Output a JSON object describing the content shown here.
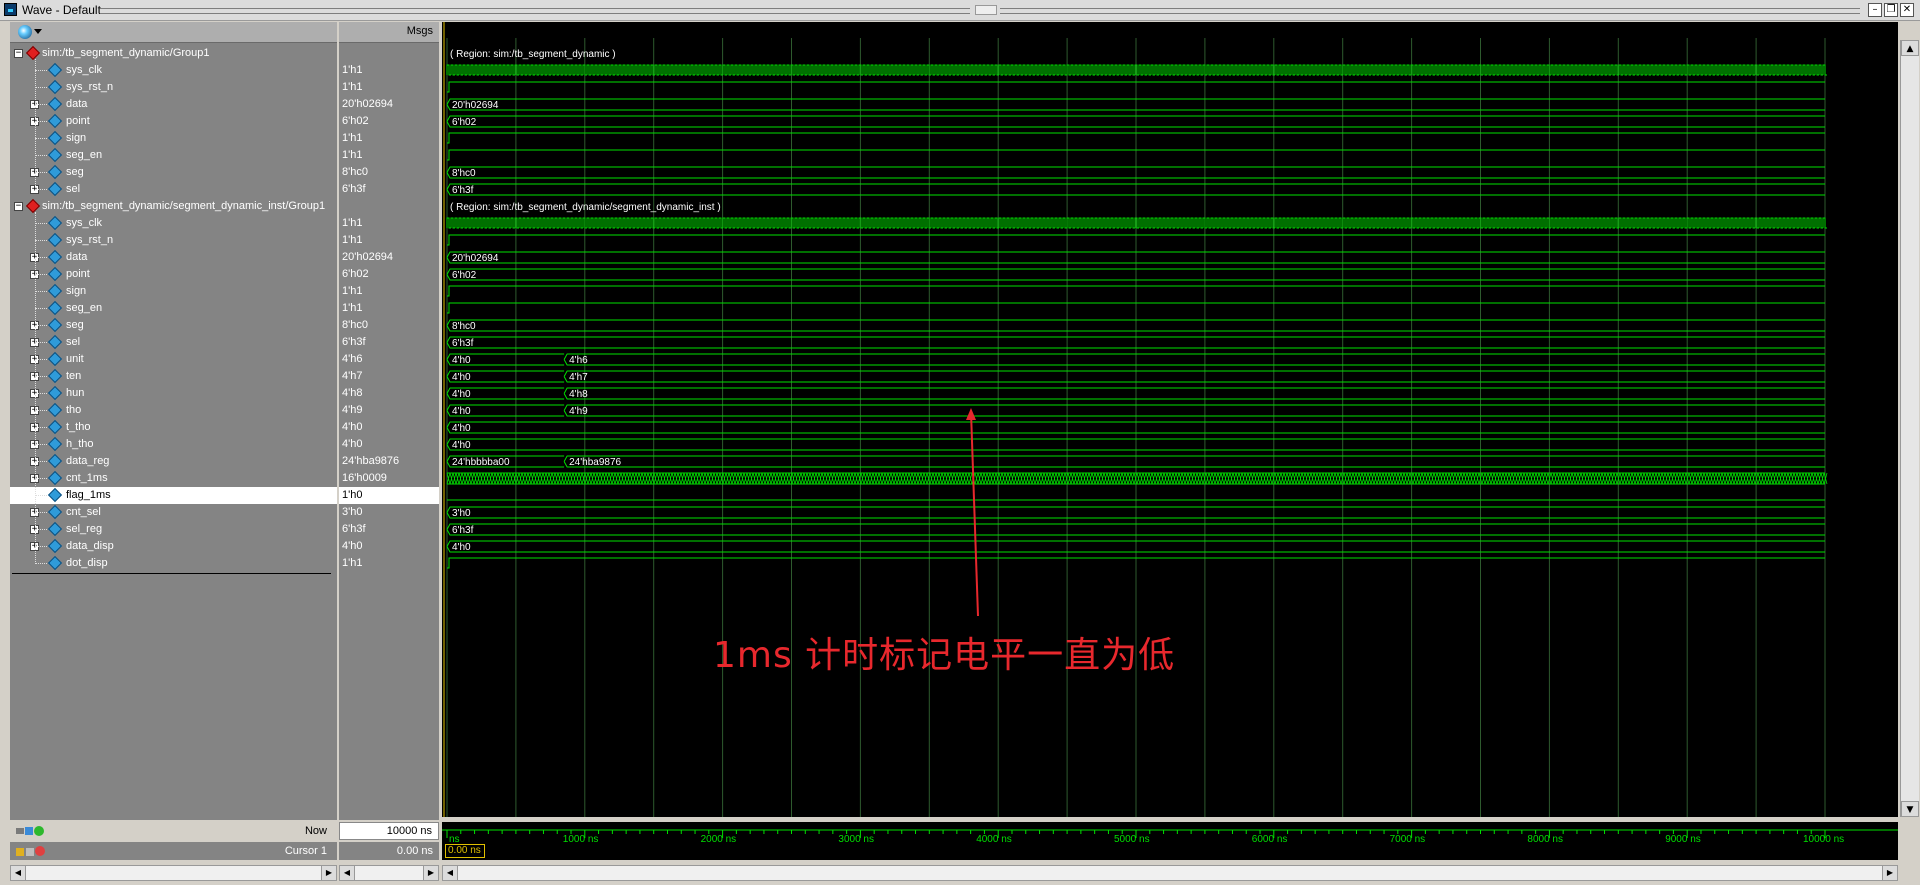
{
  "window": {
    "title": "Wave - Default"
  },
  "header": {
    "msgs_label": "Msgs"
  },
  "rows": [
    {
      "name": "sim:/tb_segment_dynamic/Group1",
      "value": "",
      "type": "group",
      "indent": 0
    },
    {
      "name": "sys_clk",
      "value": "1'h1",
      "type": "signal",
      "indent": 1
    },
    {
      "name": "sys_rst_n",
      "value": "1'h1",
      "type": "signal",
      "indent": 1
    },
    {
      "name": "data",
      "value": "20'h02694",
      "type": "bus",
      "indent": 1
    },
    {
      "name": "point",
      "value": "6'h02",
      "type": "bus",
      "indent": 1
    },
    {
      "name": "sign",
      "value": "1'h1",
      "type": "signal",
      "indent": 1
    },
    {
      "name": "seg_en",
      "value": "1'h1",
      "type": "signal",
      "indent": 1
    },
    {
      "name": "seg",
      "value": "8'hc0",
      "type": "bus",
      "indent": 1
    },
    {
      "name": "sel",
      "value": "6'h3f",
      "type": "bus",
      "indent": 1
    },
    {
      "name": "sim:/tb_segment_dynamic/segment_dynamic_inst/Group1",
      "value": "",
      "type": "group",
      "indent": 0
    },
    {
      "name": "sys_clk",
      "value": "1'h1",
      "type": "signal",
      "indent": 1
    },
    {
      "name": "sys_rst_n",
      "value": "1'h1",
      "type": "signal",
      "indent": 1
    },
    {
      "name": "data",
      "value": "20'h02694",
      "type": "bus",
      "indent": 1
    },
    {
      "name": "point",
      "value": "6'h02",
      "type": "bus",
      "indent": 1
    },
    {
      "name": "sign",
      "value": "1'h1",
      "type": "signal",
      "indent": 1
    },
    {
      "name": "seg_en",
      "value": "1'h1",
      "type": "signal",
      "indent": 1
    },
    {
      "name": "seg",
      "value": "8'hc0",
      "type": "bus",
      "indent": 1
    },
    {
      "name": "sel",
      "value": "6'h3f",
      "type": "bus",
      "indent": 1
    },
    {
      "name": "unit",
      "value": "4'h6",
      "type": "bus",
      "indent": 1
    },
    {
      "name": "ten",
      "value": "4'h7",
      "type": "bus",
      "indent": 1
    },
    {
      "name": "hun",
      "value": "4'h8",
      "type": "bus",
      "indent": 1
    },
    {
      "name": "tho",
      "value": "4'h9",
      "type": "bus",
      "indent": 1
    },
    {
      "name": "t_tho",
      "value": "4'h0",
      "type": "bus",
      "indent": 1
    },
    {
      "name": "h_tho",
      "value": "4'h0",
      "type": "bus",
      "indent": 1
    },
    {
      "name": "data_reg",
      "value": "24'hba9876",
      "type": "bus",
      "indent": 1
    },
    {
      "name": "cnt_1ms",
      "value": "16'h0009",
      "type": "bus",
      "indent": 1
    },
    {
      "name": "flag_1ms",
      "value": "1'h0",
      "type": "signal",
      "indent": 1,
      "selected": true
    },
    {
      "name": "cnt_sel",
      "value": "3'h0",
      "type": "bus",
      "indent": 1
    },
    {
      "name": "sel_reg",
      "value": "6'h3f",
      "type": "bus",
      "indent": 1
    },
    {
      "name": "data_disp",
      "value": "4'h0",
      "type": "bus",
      "indent": 1
    },
    {
      "name": "dot_disp",
      "value": "1'h1",
      "type": "signal",
      "indent": 1
    }
  ],
  "waves": {
    "region1": "( Region: sim:/tb_segment_dynamic )",
    "region2": "( Region: sim:/tb_segment_dynamic/segment_dynamic_inst )",
    "bus_labels": [
      {
        "row": 3,
        "segments": [
          "20'h02694"
        ]
      },
      {
        "row": 4,
        "segments": [
          "6'h02"
        ]
      },
      {
        "row": 7,
        "segments": [
          "8'hc0"
        ]
      },
      {
        "row": 8,
        "segments": [
          "6'h3f"
        ]
      },
      {
        "row": 12,
        "segments": [
          "20'h02694"
        ]
      },
      {
        "row": 13,
        "segments": [
          "6'h02"
        ]
      },
      {
        "row": 16,
        "segments": [
          "8'hc0"
        ]
      },
      {
        "row": 17,
        "segments": [
          "6'h3f"
        ]
      },
      {
        "row": 18,
        "segments": [
          "4'h0",
          "4'h6"
        ]
      },
      {
        "row": 19,
        "segments": [
          "4'h0",
          "4'h7"
        ]
      },
      {
        "row": 20,
        "segments": [
          "4'h0",
          "4'h8"
        ]
      },
      {
        "row": 21,
        "segments": [
          "4'h0",
          "4'h9"
        ]
      },
      {
        "row": 22,
        "segments": [
          "4'h0"
        ]
      },
      {
        "row": 23,
        "segments": [
          "4'h0"
        ]
      },
      {
        "row": 24,
        "segments": [
          "24'hbbbba00",
          "24'hba9876"
        ]
      },
      {
        "row": 27,
        "segments": [
          "3'h0"
        ]
      },
      {
        "row": 28,
        "segments": [
          "6'h3f"
        ]
      },
      {
        "row": 29,
        "segments": [
          "4'h0"
        ]
      }
    ]
  },
  "annotation": "1ms 计时标记电平一直为低",
  "footer": {
    "now_label": "Now",
    "now_value": "10000 ns",
    "cursor_label": "Cursor 1",
    "cursor_value": "0.00 ns",
    "cursor_marker": "0.00 ns",
    "ticks": [
      "ns",
      "1000 ns",
      "2000 ns",
      "3000 ns",
      "4000 ns",
      "5000 ns",
      "6000 ns",
      "7000 ns",
      "8000 ns",
      "9000 ns",
      "10000 ns"
    ]
  },
  "colors": {
    "wave": "#00e000",
    "annotation": "#e8282d",
    "background": "#000000",
    "pane": "#848484"
  }
}
